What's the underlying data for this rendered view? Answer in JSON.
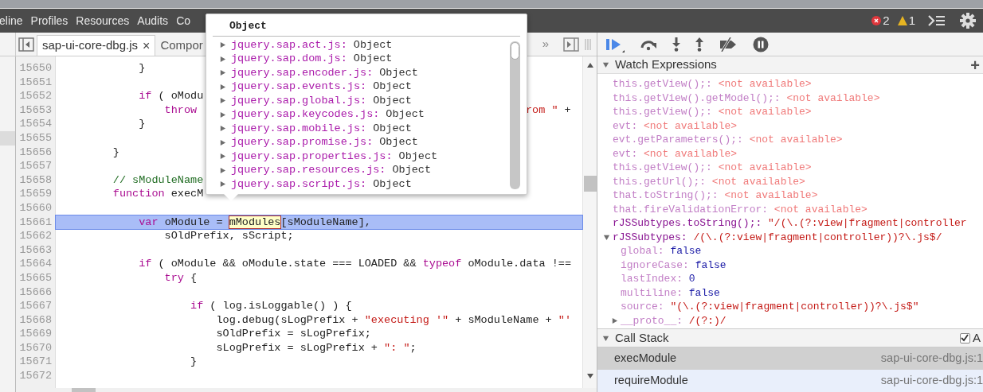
{
  "menu": {
    "items": [
      "eline",
      "Profiles",
      "Resources",
      "Audits",
      "Co"
    ],
    "error_count": "2",
    "warning_count": "1"
  },
  "editor": {
    "tabs": [
      {
        "label": "sap-ui-core-dbg.js",
        "selected": true,
        "close": "×"
      },
      {
        "label": "Compor",
        "selected": false
      }
    ],
    "overflow": "»",
    "lines": [
      {
        "number": "15650",
        "code": [
          {
            "text": "            }",
            "kind": "plain"
          }
        ]
      },
      {
        "number": "15651"
      },
      {
        "number": "15652",
        "code": [
          {
            "text": "            if",
            "kind": "keyword"
          },
          {
            "text": " ( oModu",
            "kind": "plain"
          }
        ]
      },
      {
        "number": "15653",
        "code": [
          {
            "text": "                throw",
            "kind": "keyword"
          }
        ],
        "tail": [
          {
            "text": "rom \"",
            "kind": "string"
          },
          {
            "text": " +",
            "kind": "plain"
          }
        ]
      },
      {
        "number": "15654",
        "code": [
          {
            "text": "            }",
            "kind": "plain"
          }
        ]
      },
      {
        "number": "15655",
        "selected": true
      },
      {
        "number": "15656",
        "code": [
          {
            "text": "        }",
            "kind": "plain"
          }
        ]
      },
      {
        "number": "15657"
      },
      {
        "number": "15658",
        "code": [
          {
            "text": "        // sModuleName",
            "kind": "comment"
          }
        ]
      },
      {
        "number": "15659",
        "code": [
          {
            "text": "        function",
            "kind": "keyword"
          },
          {
            "text": " execM",
            "kind": "plain"
          }
        ]
      },
      {
        "number": "15660"
      },
      {
        "number": "15661",
        "current": true,
        "code": [
          {
            "text": "            var",
            "kind": "keyword"
          },
          {
            "text": " oModule = ",
            "kind": "plain"
          },
          {
            "text": "mModules",
            "kind": "hover"
          },
          {
            "text": "[sModuleName],",
            "kind": "plain"
          }
        ]
      },
      {
        "number": "15662",
        "code": [
          {
            "text": "                sOldPrefix, sScript;",
            "kind": "plain"
          }
        ]
      },
      {
        "number": "15663"
      },
      {
        "number": "15664",
        "code": [
          {
            "text": "            if",
            "kind": "keyword"
          },
          {
            "text": " ( oModule && oModule.state === LOADED && ",
            "kind": "plain"
          },
          {
            "text": "typeof",
            "kind": "keyword"
          },
          {
            "text": " oModule.data !==",
            "kind": "plain"
          }
        ]
      },
      {
        "number": "15665",
        "code": [
          {
            "text": "                try",
            "kind": "keyword"
          },
          {
            "text": " {",
            "kind": "plain"
          }
        ]
      },
      {
        "number": "15666"
      },
      {
        "number": "15667",
        "code": [
          {
            "text": "                    if",
            "kind": "keyword"
          },
          {
            "text": " ( log.isLoggable() ) {",
            "kind": "plain"
          }
        ]
      },
      {
        "number": "15668",
        "code": [
          {
            "text": "                        log.debug(sLogPrefix + ",
            "kind": "plain"
          },
          {
            "text": "\"executing '\"",
            "kind": "string"
          },
          {
            "text": " + sModuleName + ",
            "kind": "plain"
          },
          {
            "text": "\"'",
            "kind": "string"
          }
        ]
      },
      {
        "number": "15669",
        "code": [
          {
            "text": "                        sOldPrefix = sLogPrefix;",
            "kind": "plain"
          }
        ]
      },
      {
        "number": "15670",
        "code": [
          {
            "text": "                        sLogPrefix = sLogPrefix + ",
            "kind": "plain"
          },
          {
            "text": "\": \"",
            "kind": "string"
          },
          {
            "text": ";",
            "kind": "plain"
          }
        ]
      },
      {
        "number": "15671",
        "code": [
          {
            "text": "                    }",
            "kind": "plain"
          }
        ]
      },
      {
        "number": "15672"
      }
    ]
  },
  "popup": {
    "title": "Object",
    "entries": [
      {
        "name": "jquery.sap.act.js:",
        "value": "Object"
      },
      {
        "name": "jquery.sap.dom.js:",
        "value": "Object"
      },
      {
        "name": "jquery.sap.encoder.js:",
        "value": "Object"
      },
      {
        "name": "jquery.sap.events.js:",
        "value": "Object"
      },
      {
        "name": "jquery.sap.global.js:",
        "value": "Object"
      },
      {
        "name": "jquery.sap.keycodes.js:",
        "value": "Object"
      },
      {
        "name": "jquery.sap.mobile.js:",
        "value": "Object"
      },
      {
        "name": "jquery.sap.promise.js:",
        "value": "Object"
      },
      {
        "name": "jquery.sap.properties.js:",
        "value": "Object"
      },
      {
        "name": "jquery.sap.resources.js:",
        "value": "Object"
      },
      {
        "name": "jquery.sap.script.js:",
        "value": "Object"
      }
    ]
  },
  "watch": {
    "title": "Watch Expressions",
    "add": "+",
    "items": [
      {
        "name": "this.getView();:",
        "value": "<not available>",
        "kind": "unavailable"
      },
      {
        "name": "this.getView().getModel();:",
        "value": "<not available>",
        "kind": "unavailable"
      },
      {
        "name": "this.getView();:",
        "value": "<not available>",
        "kind": "unavailable"
      },
      {
        "name": "evt:",
        "value": "<not available>",
        "kind": "unavailable"
      },
      {
        "name": "evt.getParameters();:",
        "value": "<not available>",
        "kind": "unavailable"
      },
      {
        "name": "evt:",
        "value": "<not available>",
        "kind": "unavailable"
      },
      {
        "name": "this.getView();:",
        "value": "<not available>",
        "kind": "unavailable"
      },
      {
        "name": "this.getUrl();:",
        "value": "<not available>",
        "kind": "unavailable"
      },
      {
        "name": "that.toString();:",
        "value": "<not available>",
        "kind": "unavailable"
      },
      {
        "name": "that.fireValidationError:",
        "value": "<not available>",
        "kind": "unavailable"
      },
      {
        "name": "rJSSubtypes.toString();:",
        "value": "\"/(\\.(?:view|fragment|controller",
        "kind": "string"
      },
      {
        "name": "rJSSubtypes:",
        "value": "/(\\.(?:view|fragment|controller))?\\.js$/",
        "kind": "regexp",
        "expanded": true,
        "children": [
          {
            "name": "global:",
            "value": "false",
            "kind": "boolean"
          },
          {
            "name": "ignoreCase:",
            "value": "false",
            "kind": "boolean"
          },
          {
            "name": "lastIndex:",
            "value": "0",
            "kind": "number"
          },
          {
            "name": "multiline:",
            "value": "false",
            "kind": "boolean"
          },
          {
            "name": "source:",
            "value": "\"(\\.(?:view|fragment|controller))?\\.js$\"",
            "kind": "string"
          },
          {
            "name": "__proto__:",
            "value": "/(?:)/",
            "kind": "regexp",
            "expanded": false
          }
        ]
      }
    ]
  },
  "call_stack": {
    "title": "Call Stack",
    "async": {
      "label": "A",
      "checked": true
    },
    "frames": [
      {
        "function": "execModule",
        "location": "sap-ui-core-dbg.js:1",
        "selected": true
      },
      {
        "function": "requireModule",
        "location": "sap-ui-core-dbg.js:1",
        "selected": false
      }
    ]
  }
}
